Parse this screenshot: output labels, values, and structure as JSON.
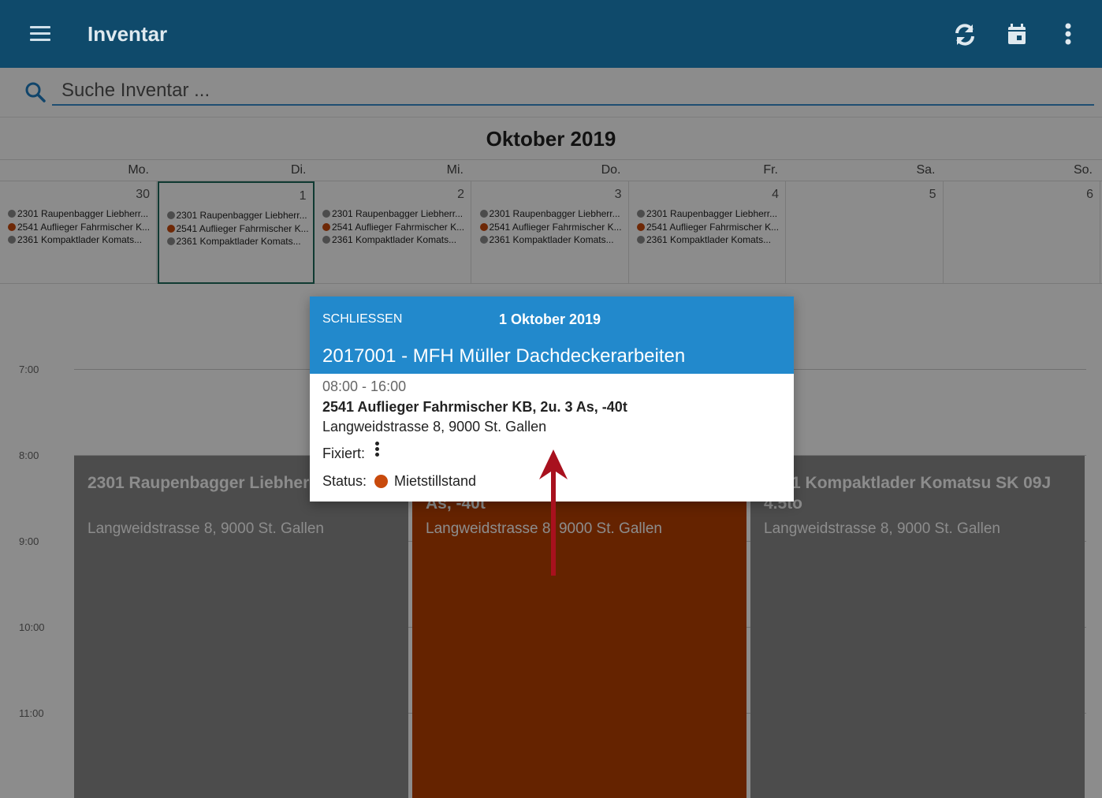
{
  "app": {
    "title": "Inventar"
  },
  "search": {
    "placeholder": "Suche Inventar ..."
  },
  "calendar": {
    "month": "Oktober 2019",
    "weekdays": [
      "Mo.",
      "Di.",
      "Mi.",
      "Do.",
      "Fr.",
      "Sa.",
      "So."
    ],
    "days": [
      {
        "num": "30",
        "events": true
      },
      {
        "num": "1",
        "events": true,
        "selected": true
      },
      {
        "num": "2",
        "events": true
      },
      {
        "num": "3",
        "events": true
      },
      {
        "num": "4",
        "events": true
      },
      {
        "num": "5",
        "events": false
      },
      {
        "num": "6",
        "events": false
      }
    ],
    "event_labels": [
      "2301 Raupenbagger Liebherr...",
      "2541 Auflieger Fahrmischer K...",
      "2361 Kompaktlader Komats..."
    ],
    "hours": [
      "7:00",
      "8:00",
      "9:00",
      "10:00",
      "11:00"
    ],
    "blocks": [
      {
        "title": "2301 Raupenbagger Liebherr litr. ÖKO",
        "address": "Langweidstrasse 8, 9000 St. Gallen"
      },
      {
        "title": "2541 Auflieger Fahrmischer KB, 2u. 3 As, -40t",
        "address": "Langweidstrasse 8, 9000 St. Gallen"
      },
      {
        "title": "2361 Kompaktlader Komatsu SK 09J 4.5to",
        "address": "Langweidstrasse 8, 9000 St. Gallen"
      }
    ]
  },
  "dialog": {
    "close_label": "SCHLIESSEN",
    "date": "1 Oktober 2019",
    "job": "2017001 - MFH Müller Dachdeckerarbeiten",
    "time_start": "08:00",
    "time_end": "16:00",
    "item": "2541 Auflieger Fahrmischer KB, 2u. 3 As, -40t",
    "address": "Langweidstrasse 8, 9000 St. Gallen",
    "fixed_label": "Fixiert:",
    "status_label": "Status:",
    "status_value": "Mietstillstand"
  },
  "colors": {
    "appbar": "#0f4a6b",
    "accent": "#2289cc",
    "status_orange": "#c84a0c",
    "status_grey": "#8a8a8a",
    "block_red": "#8a2f00",
    "arrow": "#a8111e"
  }
}
